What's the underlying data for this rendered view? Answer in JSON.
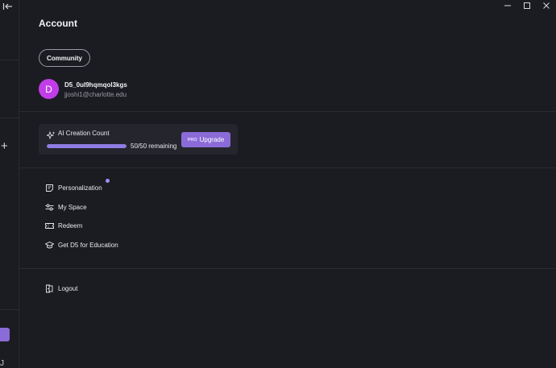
{
  "window": {
    "controls": [
      "minimize-icon",
      "maximize-icon",
      "close-icon"
    ],
    "rail_bottom_char": "J"
  },
  "account": {
    "title": "Account",
    "community_button": "Community"
  },
  "user": {
    "avatar_initial": "D",
    "name": "D5_0ul9hqmqol3kgs",
    "email": "jjoshi1@charlotte.edu"
  },
  "ai_creation": {
    "label": "AI Creation Count",
    "used": 50,
    "total": 50,
    "fraction_remaining": 1.0,
    "remaining_text": "50/50 remaining",
    "pro_tag": "PRO",
    "upgrade_label": "Upgrade"
  },
  "menu": {
    "personalization": "Personalization",
    "my_space": "My Space",
    "redeem": "Redeem",
    "education": "Get D5 for Education",
    "logout": "Logout"
  },
  "colors": {
    "background": "#1b1c21",
    "accent": "#8b6bd8",
    "avatar": "#c13de9",
    "progress": "#8f7de3"
  }
}
